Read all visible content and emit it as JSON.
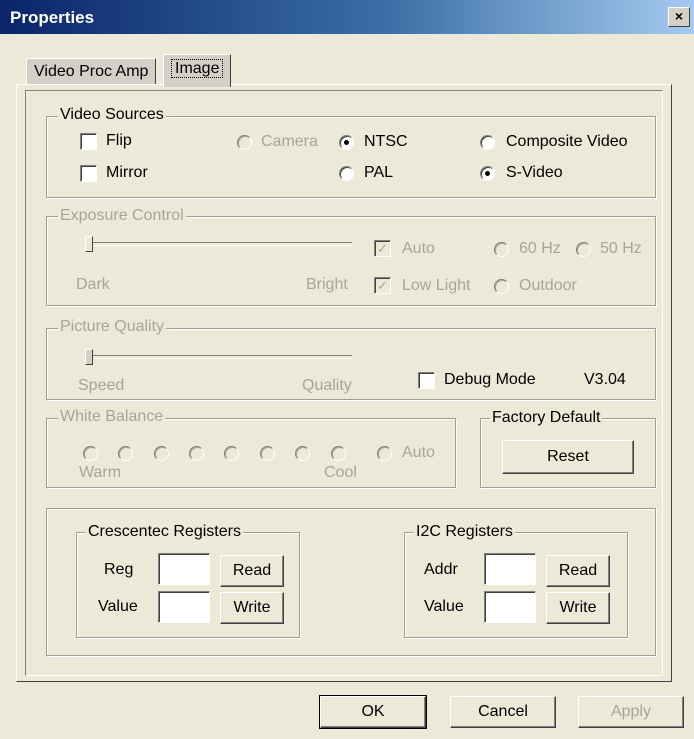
{
  "window": {
    "title": "Properties",
    "close_glyph": "×"
  },
  "tabs": [
    {
      "label": "Video Proc Amp"
    },
    {
      "label": "Image"
    }
  ],
  "video_sources": {
    "legend": "Video Sources",
    "flip": "Flip",
    "mirror": "Mirror",
    "camera": "Camera",
    "ntsc": "NTSC",
    "pal": "PAL",
    "composite": "Composite Video",
    "svideo": "S-Video",
    "selected": [
      "NTSC",
      "S-Video"
    ]
  },
  "exposure": {
    "legend": "Exposure Control",
    "dark": "Dark",
    "bright": "Bright",
    "auto": "Auto",
    "low_light": "Low Light",
    "hz60": "60 Hz",
    "hz50": "50 Hz",
    "outdoor": "Outdoor",
    "checkmark": "✓",
    "slider_value": 0
  },
  "picture_quality": {
    "legend": "Picture Quality",
    "speed": "Speed",
    "quality": "Quality",
    "debug_mode": "Debug Mode",
    "version": "V3.04",
    "slider_value": 0
  },
  "white_balance": {
    "legend": "White Balance",
    "warm": "Warm",
    "cool": "Cool",
    "auto": "Auto"
  },
  "factory_default": {
    "legend": "Factory Default",
    "reset": "Reset"
  },
  "crescentec": {
    "legend": "Crescentec Registers",
    "reg": "Reg",
    "value": "Value",
    "read": "Read",
    "write": "Write"
  },
  "i2c": {
    "legend": "I2C Registers",
    "addr": "Addr",
    "value": "Value",
    "read": "Read",
    "write": "Write"
  },
  "footer": {
    "ok": "OK",
    "cancel": "Cancel",
    "apply": "Apply"
  }
}
